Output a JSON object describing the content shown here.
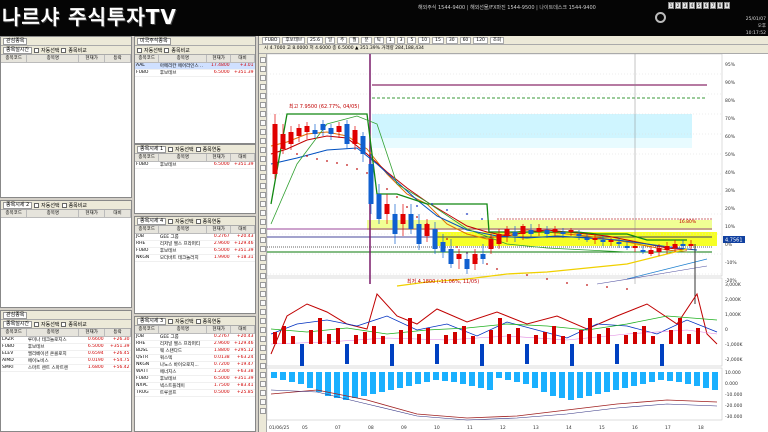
{
  "header": {
    "logo": "나르샤 주식투자TV",
    "hotlines": "해외주식 1544-9400 | 해외선물/FX마진 1544-9500 | 나이트데스크 1544-9400",
    "date": "25/01/07",
    "time": "오후 10:17:52",
    "window_buttons": [
      "1",
      "2",
      "3",
      "4",
      "5",
      "6",
      "7",
      "8",
      "9"
    ]
  },
  "panel1": {
    "dropdown": "관심종목",
    "watch_label": "종목실시간",
    "auto_label": "자동선택",
    "compare_label": "종목비교",
    "columns": [
      "종목코드",
      "종목명",
      "현재가",
      "등락"
    ],
    "rows": []
  },
  "panel2": {
    "dropdown": "미국주식종목",
    "columns": [
      "종목코드",
      "종목명",
      "현재가",
      "대비"
    ],
    "rows": [
      {
        "code": "AAL",
        "name": "아메리칸 에어라인스 ..",
        "price": "17.4800",
        "chg": "+3.01",
        "dir": "up"
      },
      {
        "code": "FUBO",
        "name": "후보테브",
        "price": "6.5000",
        "chg": "+351.39",
        "dir": "up"
      }
    ]
  },
  "panel3": {
    "title": "종목시세 1",
    "auto_label": "자동선택",
    "compare_label": "종목연동",
    "columns": [
      "종목코드",
      "종목명",
      "현재가",
      "대비"
    ],
    "rows": [
      {
        "code": "FUBO",
        "name": "후보테브",
        "price": "6.5000",
        "chg": "+351.39",
        "dir": "up"
      }
    ]
  },
  "panel4": {
    "title": "종목시세 2",
    "auto_label": "자동선택",
    "compare_label": "종목비교",
    "columns": [
      "종목코드",
      "종목명",
      "현재가",
      "대비"
    ],
    "rows": []
  },
  "panel5": {
    "title": "종목시세 4",
    "auto_label": "자동선택",
    "compare_label": "종목연동",
    "columns": [
      "종목코드",
      "종목명",
      "현재가",
      "대비"
    ],
    "rows": [
      {
        "code": "JOB",
        "name": "GEE 그룹",
        "price": "0.2767",
        "chg": "+20.43",
        "dir": "up"
      },
      {
        "code": "RHE",
        "name": "리저널 헬스 프라퍼티",
        "price": "2.9600",
        "chg": "+129.46",
        "dir": "up"
      },
      {
        "code": "FUBO",
        "name": "후보테브",
        "price": "6.5000",
        "chg": "+351.39",
        "dir": "up"
      },
      {
        "code": "NKGN",
        "name": "모더바트 테크놀러지",
        "price": "1.9900",
        "chg": "+18.31",
        "dir": "up"
      }
    ]
  },
  "panel6": {
    "dropdown": "관심종목",
    "watch_label": "종목실시간",
    "auto_label": "자동선택",
    "compare_label": "종목비교",
    "columns": [
      "종목코드",
      "종목명",
      "현재가",
      "등락"
    ],
    "rows": [
      {
        "code": "LAZR",
        "name": "루미나 테크놀로지스",
        "price": "0.6600",
        "chg": "+26.30",
        "dir": "up"
      },
      {
        "code": "FUBO",
        "name": "후보테브",
        "price": "6.5000",
        "chg": "+351.39",
        "dir": "up"
      },
      {
        "code": "ELEV",
        "name": "엘리베이션 온콜로지",
        "price": "0.6594",
        "chg": "+26.45",
        "dir": "up"
      },
      {
        "code": "AIMD",
        "name": "에이노비스",
        "price": "0.0190",
        "chg": "+54.75",
        "dir": "up"
      },
      {
        "code": "SMRT",
        "name": "스마트 렌트 스마트렌",
        "price": "1.6800",
        "chg": "+56.42",
        "dir": "up"
      }
    ]
  },
  "panel7": {
    "title": "종목시세 3",
    "auto_label": "자동선택",
    "compare_label": "종목연동",
    "columns": [
      "종목코드",
      "종목명",
      "현재가",
      "대비"
    ],
    "rows": [
      {
        "code": "JOB",
        "name": "GEE 그룹",
        "price": "0.2767",
        "chg": "+20.43",
        "dir": "up"
      },
      {
        "code": "RHE",
        "name": "리저널 헬스 프라퍼티",
        "price": "2.9600",
        "chg": "+129.46",
        "dir": "up"
      },
      {
        "code": "BDSL",
        "name": "웨 스탠다드",
        "price": "1.8800",
        "chg": "+295.12",
        "dir": "up"
      },
      {
        "code": "QSTR",
        "name": "쿼스텍",
        "price": "0.0138",
        "chg": "+63.24",
        "dir": "up"
      },
      {
        "code": "NKGN",
        "name": "나노스 바이오로지...",
        "price": "0.7200",
        "chg": "+19.47",
        "dir": "up"
      },
      {
        "code": "WATT",
        "name": "에너지스",
        "price": "1.2300",
        "chg": "+63.38",
        "dir": "up"
      },
      {
        "code": "FUBO",
        "name": "후보테브",
        "price": "6.5000",
        "chg": "+351.39",
        "dir": "up"
      },
      {
        "code": "NXPL",
        "name": "넥스트플레이",
        "price": "1.7500",
        "chg": "+83.41",
        "dir": "up"
      },
      {
        "code": "TRUG",
        "name": "트루골프",
        "price": "0.5000",
        "chg": "+25.85",
        "dir": "up"
      }
    ]
  },
  "chart": {
    "toolbar1": [
      "FUBO",
      "후보테브",
      "25.6",
      "일",
      "주",
      "월",
      "분",
      "틱",
      "1",
      "3",
      "5",
      "10",
      "15",
      "30",
      "60",
      "120",
      "조회"
    ],
    "toolbar2": "시 4.7000  고 8.0000  저 4.6000  종 6.5000  ▲ 351.39%  거래량 284,188,434",
    "annotation_high": "최고 7.9500 (62.77%, 04/05)",
    "annotation_low": "최저 4.1800 (-11.06%, 11/05)",
    "pct_label": "16.80%",
    "price_tag": "4.7561",
    "x_labels": [
      "01/06/25",
      "05",
      "07",
      "08",
      "09",
      "10",
      "11",
      "12",
      "13",
      "14",
      "15",
      "16",
      "17",
      "18"
    ],
    "right_labels_main": [
      "95%",
      "90%",
      "80%",
      "70%",
      "60%",
      "50%",
      "40%",
      "30%",
      "20%",
      "10%",
      "0%",
      "-10%",
      "-20%"
    ],
    "right_labels_sub": [
      "3,000K",
      "2,000K",
      "1,000K",
      "0",
      "-1,000K",
      "-2,000K"
    ],
    "right_labels_sub2": [
      "10.000",
      "0.000",
      "-10.000",
      "-20.000",
      "-30.000"
    ],
    "colors": {
      "up": "#e00000",
      "down": "#1060d0",
      "volume": "#00aaff"
    }
  }
}
